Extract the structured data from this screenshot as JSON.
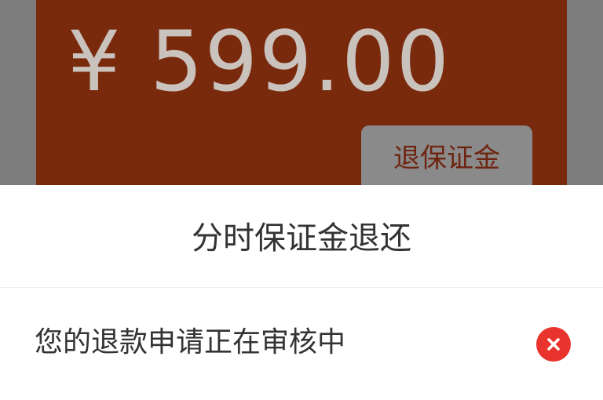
{
  "deposit": {
    "amount": "¥ 599.00",
    "refund_button_label": "退保证金"
  },
  "sheet": {
    "title": "分时保证金退还",
    "status_message": "您的退款申请正在审核中",
    "close_icon": "close-icon",
    "accent_color": "#e8342c"
  }
}
